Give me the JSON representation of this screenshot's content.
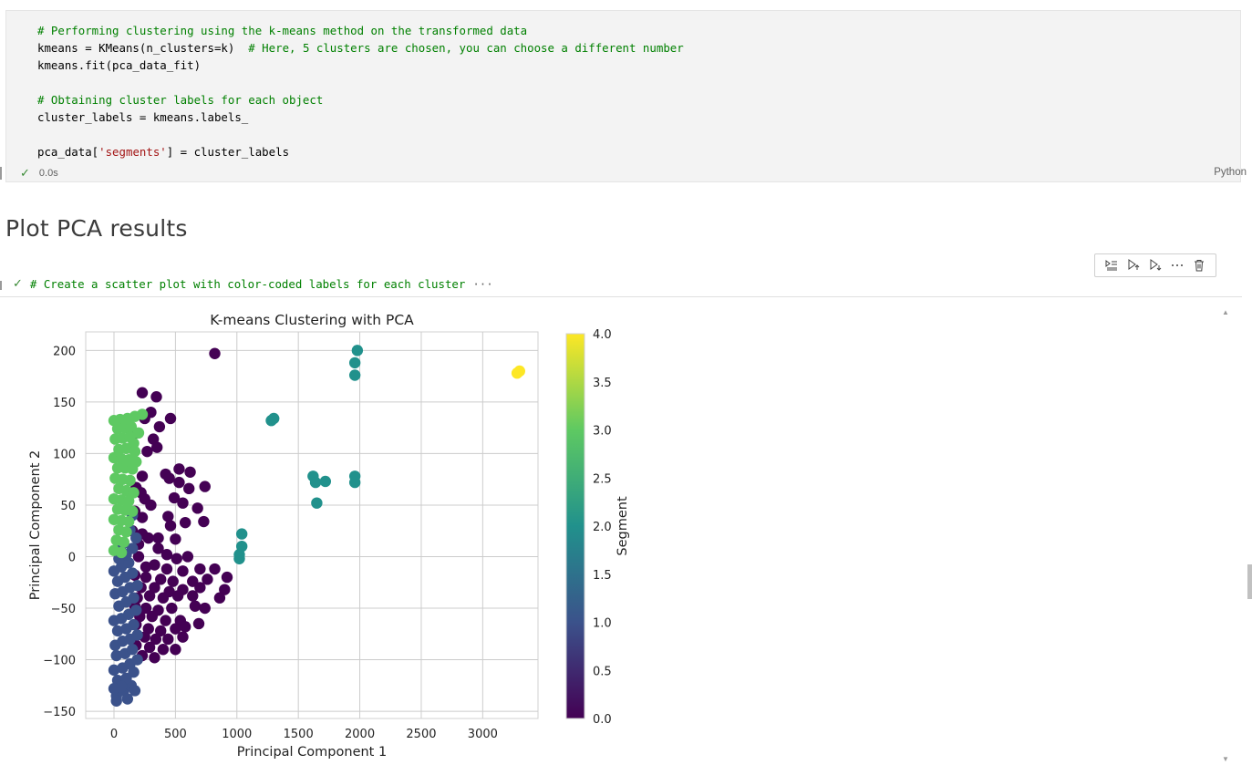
{
  "code_cell": {
    "lines": [
      {
        "cm": "# Performing clustering using the k-means method on the transformed data"
      },
      {
        "a": "kmeans = KMeans(n_clusters=k)  ",
        "cm": "# Here, 5 clusters are chosen, you can choose a different number"
      },
      {
        "a": "kmeans.fit(pca_data_fit)"
      },
      {
        "a": ""
      },
      {
        "cm": "# Obtaining cluster labels for each object"
      },
      {
        "a": "cluster_labels = kmeans.labels_"
      },
      {
        "a": ""
      },
      {
        "a": "pca_data[",
        "str": "'segments'",
        "b": "] = cluster_labels"
      }
    ],
    "exec_time": "0.0s",
    "language": "Python"
  },
  "markdown": {
    "heading": "Plot PCA results"
  },
  "collapsed_cell": {
    "code": "# Create a scatter plot with color-coded labels for each cluster",
    "ellipsis": "···"
  },
  "toolbar": {
    "icons": [
      "execute-above-icon",
      "run-above-icon",
      "run-below-icon",
      "more-icon",
      "delete-icon"
    ]
  },
  "chart_data": {
    "type": "scatter",
    "title": "K-means Clustering with PCA",
    "xlabel": "Principal Component 1",
    "ylabel": "Principal Component 2",
    "xlim": [
      -230,
      3450
    ],
    "ylim": [
      -157,
      218
    ],
    "xticks": [
      0,
      500,
      1000,
      1500,
      2000,
      2500,
      3000
    ],
    "yticks": [
      -150,
      -100,
      -50,
      0,
      50,
      100,
      150,
      200
    ],
    "grid": true,
    "colorbar": {
      "label": "Segment",
      "range": [
        0.0,
        4.0
      ],
      "ticks": [
        "0.0",
        "0.5",
        "1.0",
        "1.5",
        "2.0",
        "2.5",
        "3.0",
        "3.5",
        "4.0"
      ],
      "colors": [
        "#440154",
        "#3b528b",
        "#21918c",
        "#5ec962",
        "#fde725"
      ]
    },
    "clusters": [
      {
        "segment": 0,
        "color": "#440154",
        "points": [
          [
            820,
            197
          ],
          [
            230,
            159
          ],
          [
            345,
            155
          ],
          [
            300,
            140
          ],
          [
            250,
            134
          ],
          [
            460,
            134
          ],
          [
            370,
            126
          ],
          [
            160,
            119
          ],
          [
            320,
            114
          ],
          [
            350,
            106
          ],
          [
            270,
            102
          ],
          [
            530,
            85
          ],
          [
            620,
            82
          ],
          [
            230,
            78
          ],
          [
            420,
            80
          ],
          [
            450,
            76
          ],
          [
            530,
            72
          ],
          [
            740,
            68
          ],
          [
            180,
            67
          ],
          [
            610,
            66
          ],
          [
            220,
            62
          ],
          [
            250,
            56
          ],
          [
            300,
            50
          ],
          [
            490,
            57
          ],
          [
            560,
            52
          ],
          [
            680,
            47
          ],
          [
            170,
            44
          ],
          [
            230,
            38
          ],
          [
            440,
            39
          ],
          [
            460,
            30
          ],
          [
            580,
            33
          ],
          [
            730,
            34
          ],
          [
            150,
            25
          ],
          [
            230,
            22
          ],
          [
            280,
            18
          ],
          [
            360,
            18
          ],
          [
            500,
            17
          ],
          [
            200,
            12
          ],
          [
            360,
            8
          ],
          [
            430,
            2
          ],
          [
            510,
            -2
          ],
          [
            600,
            0
          ],
          [
            200,
            0
          ],
          [
            260,
            -10
          ],
          [
            330,
            -8
          ],
          [
            430,
            -12
          ],
          [
            560,
            -14
          ],
          [
            700,
            -12
          ],
          [
            820,
            -12
          ],
          [
            170,
            -18
          ],
          [
            260,
            -20
          ],
          [
            380,
            -22
          ],
          [
            480,
            -24
          ],
          [
            640,
            -24
          ],
          [
            760,
            -22
          ],
          [
            920,
            -20
          ],
          [
            220,
            -30
          ],
          [
            330,
            -30
          ],
          [
            450,
            -34
          ],
          [
            560,
            -32
          ],
          [
            700,
            -30
          ],
          [
            900,
            -32
          ],
          [
            190,
            -40
          ],
          [
            290,
            -38
          ],
          [
            400,
            -40
          ],
          [
            520,
            -38
          ],
          [
            640,
            -38
          ],
          [
            860,
            -40
          ],
          [
            170,
            -48
          ],
          [
            260,
            -50
          ],
          [
            360,
            -52
          ],
          [
            470,
            -50
          ],
          [
            660,
            -48
          ],
          [
            740,
            -50
          ],
          [
            210,
            -58
          ],
          [
            310,
            -58
          ],
          [
            420,
            -62
          ],
          [
            540,
            -62
          ],
          [
            690,
            -65
          ],
          [
            580,
            -68
          ],
          [
            180,
            -66
          ],
          [
            280,
            -70
          ],
          [
            380,
            -72
          ],
          [
            500,
            -70
          ],
          [
            250,
            -78
          ],
          [
            340,
            -80
          ],
          [
            440,
            -80
          ],
          [
            560,
            -78
          ],
          [
            180,
            -86
          ],
          [
            290,
            -88
          ],
          [
            400,
            -90
          ],
          [
            500,
            -90
          ],
          [
            230,
            -96
          ],
          [
            330,
            -98
          ]
        ]
      },
      {
        "segment": 1,
        "color": "#3b528b",
        "points": [
          [
            20,
            -135
          ],
          [
            80,
            -130
          ],
          [
            140,
            -125
          ],
          [
            30,
            -120
          ],
          [
            100,
            -118
          ],
          [
            160,
            -112
          ],
          [
            0,
            -110
          ],
          [
            70,
            -108
          ],
          [
            130,
            -104
          ],
          [
            190,
            -100
          ],
          [
            20,
            -96
          ],
          [
            90,
            -94
          ],
          [
            150,
            -90
          ],
          [
            10,
            -86
          ],
          [
            70,
            -82
          ],
          [
            130,
            -80
          ],
          [
            190,
            -76
          ],
          [
            30,
            -72
          ],
          [
            100,
            -70
          ],
          [
            160,
            -66
          ],
          [
            0,
            -62
          ],
          [
            60,
            -60
          ],
          [
            120,
            -56
          ],
          [
            180,
            -52
          ],
          [
            40,
            -48
          ],
          [
            100,
            -44
          ],
          [
            160,
            -40
          ],
          [
            10,
            -36
          ],
          [
            70,
            -34
          ],
          [
            130,
            -30
          ],
          [
            190,
            -28
          ],
          [
            30,
            -24
          ],
          [
            90,
            -20
          ],
          [
            150,
            -16
          ],
          [
            0,
            -14
          ],
          [
            60,
            -10
          ],
          [
            120,
            -6
          ],
          [
            40,
            -2
          ],
          [
            100,
            2
          ],
          [
            150,
            8
          ],
          [
            70,
            12
          ],
          [
            180,
            18
          ],
          [
            130,
            26
          ],
          [
            150,
            40
          ],
          [
            20,
            -140
          ],
          [
            110,
            -138
          ],
          [
            60,
            -126
          ],
          [
            0,
            -128
          ],
          [
            170,
            -130
          ]
        ]
      },
      {
        "segment": 2,
        "color": "#21918c",
        "points": [
          [
            1280,
            132
          ],
          [
            1300,
            134
          ],
          [
            1960,
            188
          ],
          [
            1980,
            200
          ],
          [
            1960,
            176
          ],
          [
            1620,
            78
          ],
          [
            1640,
            72
          ],
          [
            1720,
            73
          ],
          [
            1960,
            78
          ],
          [
            1960,
            72
          ],
          [
            1650,
            52
          ],
          [
            1040,
            22
          ],
          [
            1040,
            10
          ],
          [
            1020,
            2
          ],
          [
            1020,
            -2
          ]
        ]
      },
      {
        "segment": 3,
        "color": "#5ec962",
        "points": [
          [
            0,
            132
          ],
          [
            50,
            133
          ],
          [
            110,
            134
          ],
          [
            170,
            136
          ],
          [
            230,
            138
          ],
          [
            30,
            124
          ],
          [
            90,
            125
          ],
          [
            140,
            126
          ],
          [
            200,
            120
          ],
          [
            10,
            114
          ],
          [
            70,
            115
          ],
          [
            130,
            116
          ],
          [
            160,
            110
          ],
          [
            40,
            104
          ],
          [
            100,
            105
          ],
          [
            170,
            102
          ],
          [
            0,
            96
          ],
          [
            60,
            95
          ],
          [
            120,
            94
          ],
          [
            180,
            92
          ],
          [
            30,
            86
          ],
          [
            90,
            86
          ],
          [
            150,
            85
          ],
          [
            10,
            76
          ],
          [
            70,
            75
          ],
          [
            130,
            74
          ],
          [
            40,
            66
          ],
          [
            100,
            64
          ],
          [
            160,
            62
          ],
          [
            0,
            56
          ],
          [
            60,
            55
          ],
          [
            120,
            54
          ],
          [
            30,
            46
          ],
          [
            90,
            45
          ],
          [
            150,
            44
          ],
          [
            0,
            36
          ],
          [
            60,
            35
          ],
          [
            120,
            34
          ],
          [
            40,
            26
          ],
          [
            100,
            24
          ],
          [
            20,
            16
          ],
          [
            80,
            14
          ],
          [
            0,
            6
          ],
          [
            60,
            4
          ]
        ]
      },
      {
        "segment": 4,
        "color": "#fde725",
        "points": [
          [
            3280,
            178
          ],
          [
            3300,
            180
          ]
        ]
      }
    ]
  }
}
